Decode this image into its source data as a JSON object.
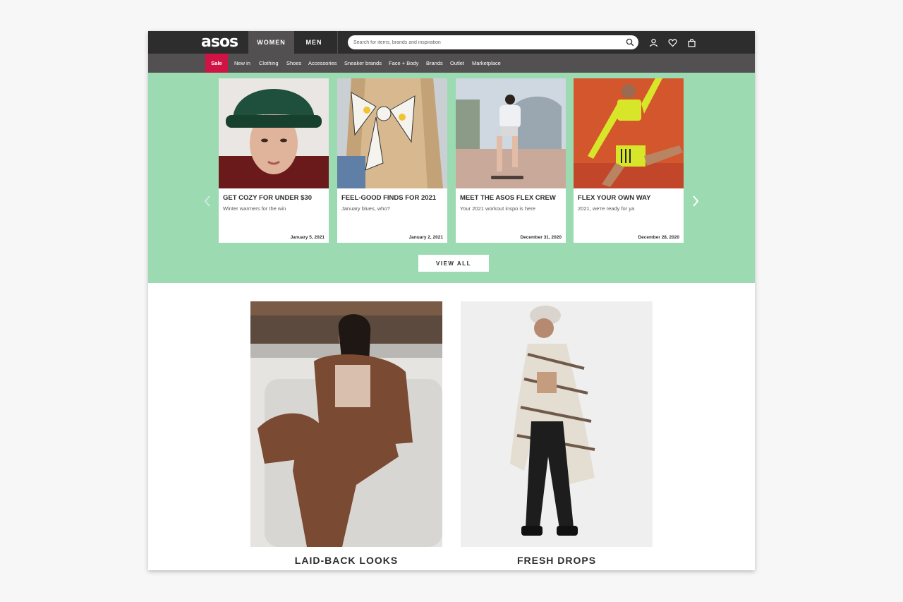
{
  "header": {
    "logo": "asos",
    "tabs": [
      "WOMEN",
      "MEN"
    ],
    "search_placeholder": "Search for items, brands and inspiration",
    "icons": [
      "search-icon",
      "account-icon",
      "heart-icon",
      "bag-icon"
    ]
  },
  "nav": {
    "items": [
      "Sale",
      "New in",
      "Clothing",
      "Shoes",
      "Accessories",
      "Sneaker brands",
      "Face + Body",
      "Brands",
      "Outlet",
      "Marketplace"
    ]
  },
  "promo": {
    "cards": [
      {
        "title": "GET COZY FOR UNDER $30",
        "subtitle": "Winter warmers for the win",
        "date": "January 5, 2021"
      },
      {
        "title": "FEEL-GOOD FINDS FOR 2021",
        "subtitle": "January blues, who?",
        "date": "January 2, 2021"
      },
      {
        "title": "MEET THE ASOS FLEX CREW",
        "subtitle": "Your 2021 workout inspo is here",
        "date": "December 31, 2020"
      },
      {
        "title": "FLEX YOUR OWN WAY",
        "subtitle": "2021, we're ready for ya",
        "date": "December 28, 2020"
      }
    ],
    "view_all": "VIEW ALL"
  },
  "features": [
    {
      "caption": "LAID-BACK LOOKS"
    },
    {
      "caption": "FRESH DROPS"
    }
  ],
  "colors": {
    "header_bg": "#2d2d2d",
    "nav_bg": "#525050",
    "sale": "#d01345",
    "promo_bg": "#9cdbb1"
  }
}
